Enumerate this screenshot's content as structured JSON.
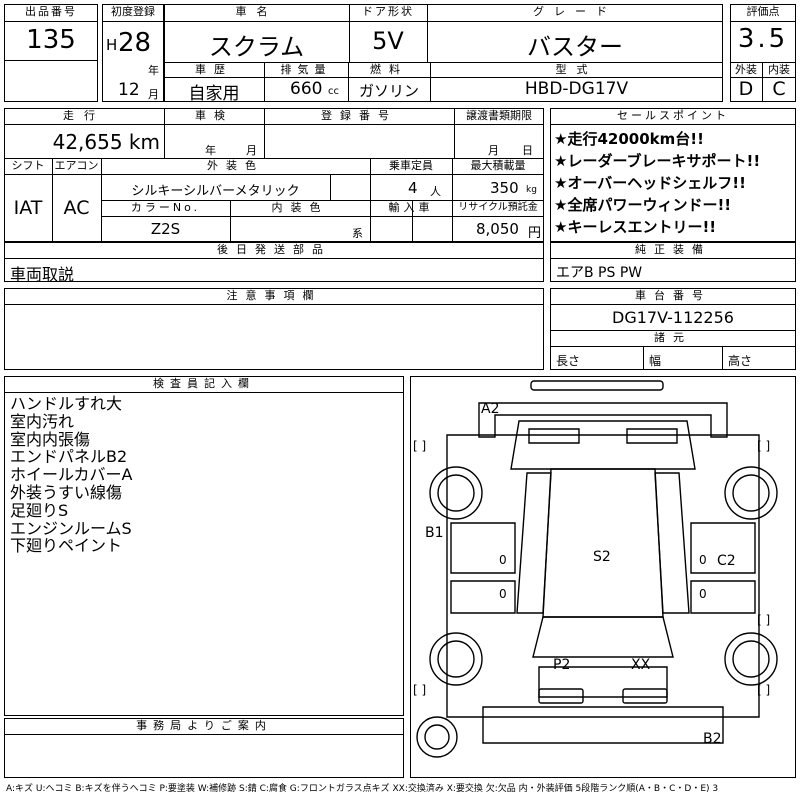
{
  "header": {
    "lot_label": "出品番号",
    "lot_no": "135",
    "first_reg_label": "初度登録",
    "era": "H",
    "year": "28",
    "year_unit": "年",
    "month": "12",
    "month_unit": "月",
    "car_name_label": "車名",
    "car_name": "スクラム",
    "door_label": "ドア形状",
    "door": "5V",
    "grade_label": "グレード",
    "grade": "バスター",
    "rating_label": "評価点",
    "rating": "3.5",
    "history_label": "車歴",
    "history": "自家用",
    "displacement_label": "排気量",
    "displacement": "660",
    "displacement_unit": "cc",
    "fuel_label": "燃料",
    "fuel": "ガソリン",
    "model_label": "型式",
    "model": "HBD-DG17V",
    "ext_label": "外装",
    "ext_grade": "D",
    "int_label": "内装",
    "int_grade": "C"
  },
  "row2": {
    "mileage_label": "走行",
    "mileage": "42,655 km",
    "inspection_label": "車検",
    "inspection_year_unit": "年",
    "inspection_month_unit": "月",
    "reg_label": "登録番号",
    "transfer_label": "譲渡書類期限",
    "transfer_month_unit": "月",
    "transfer_day_unit": "日",
    "shift_label": "シフト",
    "shift": "IAT",
    "ac_label": "エアコン",
    "ac": "AC",
    "color_label": "外装色",
    "color": "シルキーシルバーメタリック",
    "seats_label": "乗車定員",
    "seats": "4",
    "seats_unit": "人",
    "load_label": "最大積載量",
    "load": "350",
    "load_unit": "kg",
    "color_no_label": "カラーNo.",
    "color_no": "Z2S",
    "int_color_label": "内装色",
    "int_color_unit": "系",
    "import_label": "輸入車",
    "recycle_label": "リサイクル預託金",
    "recycle": "8,050",
    "recycle_unit": "円"
  },
  "sales": {
    "label": "セールスポイント",
    "items": [
      "★走行42000km台!!",
      "★レーダーブレーキサポート!!",
      "★オーバーヘッドシェルフ!!",
      "★全席パワーウィンドー!!",
      "★キーレスエントリー!!"
    ]
  },
  "later_parts": {
    "label": "後日発送部品",
    "value": "車両取説"
  },
  "equipment": {
    "label": "純正装備",
    "value": "エアB PS PW"
  },
  "caution": {
    "label": "注意事項欄"
  },
  "chassis": {
    "label": "車台番号",
    "value": "DG17V-112256",
    "spec_label": "諸元",
    "length_label": "長さ",
    "width_label": "幅",
    "height_label": "高さ"
  },
  "inspector": {
    "label": "検査員記入欄",
    "notes": [
      "ハンドルすれ大",
      "室内汚れ",
      "室内内張傷",
      "エンドパネルB2",
      "ホイールカバーA",
      "外装うすい線傷",
      "足廻りS",
      "エンジンルームS",
      "下廻りペイント"
    ]
  },
  "office": {
    "label": "事務局よりご案内"
  },
  "diagram": {
    "marks": {
      "a2": "A2",
      "b1": "B1",
      "s2": "S2",
      "c2": "C2",
      "p2": "P2",
      "xx": "XX",
      "b2": "B2"
    },
    "bracket": "[ ]",
    "zero": "0"
  },
  "legend": "A:キズ U:ヘコミ B:キズを伴うヘコミ P:要塗装 W:補修跡 S:錆 C:腐食 G:フロントガラス点キズ XX:交換済み X:要交換 欠:欠品 内・外装評価 5段階ランク順(A・B・C・D・E) 3"
}
